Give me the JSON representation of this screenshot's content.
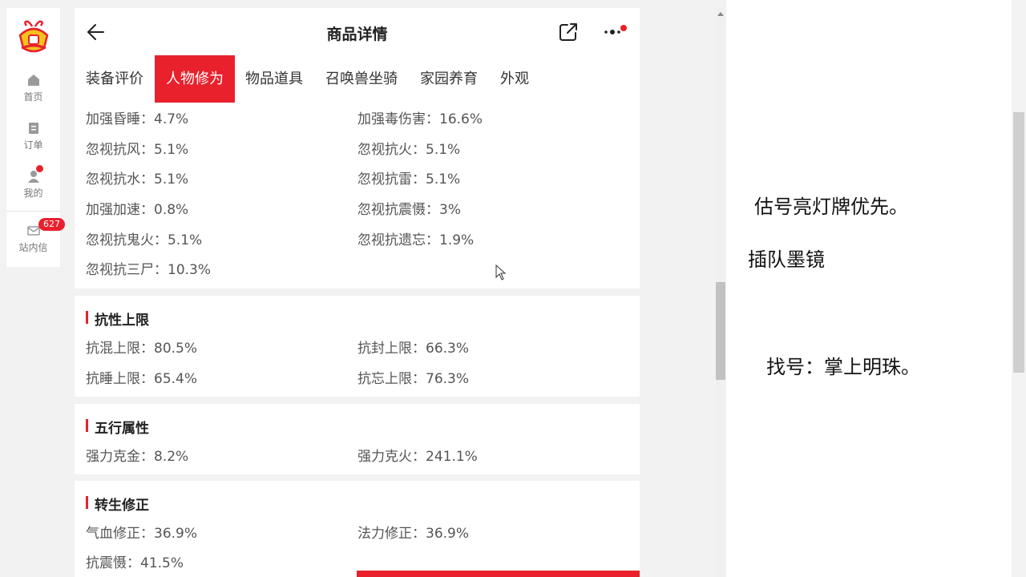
{
  "sidebar": {
    "items": [
      {
        "label": "首页",
        "icon": "home-icon"
      },
      {
        "label": "订单",
        "icon": "order-icon"
      },
      {
        "label": "我的",
        "icon": "user-icon"
      },
      {
        "label": "站内信",
        "icon": "mail-icon"
      }
    ],
    "mail_count": "627"
  },
  "header": {
    "title": "商品详情"
  },
  "tabs": [
    "装备评价",
    "人物修为",
    "物品道具",
    "召唤兽坐骑",
    "家园养育",
    "外观"
  ],
  "attributes_top": [
    [
      "加强昏睡：4.7%",
      "加强毒伤害：16.6%"
    ],
    [
      "忽视抗风：5.1%",
      "忽视抗火：5.1%"
    ],
    [
      "忽视抗水：5.1%",
      "忽视抗雷：5.1%"
    ],
    [
      "加强加速：0.8%",
      "忽视抗震慑：3%"
    ],
    [
      "忽视抗鬼火：5.1%",
      "忽视抗遗忘：1.9%"
    ],
    [
      "忽视抗三尸：10.3%",
      ""
    ]
  ],
  "resist_limit": {
    "title": "抗性上限",
    "rows": [
      [
        "抗混上限：80.5%",
        "抗封上限：66.3%"
      ],
      [
        "抗睡上限：65.4%",
        "抗忘上限：76.3%"
      ]
    ]
  },
  "five_elements": {
    "title": "五行属性",
    "rows": [
      [
        "强力克金：8.2%",
        "强力克火：241.1%"
      ]
    ]
  },
  "rebirth": {
    "title": "转生修正",
    "rows": [
      [
        "气血修正：36.9%",
        "法力修正：36.9%"
      ],
      [
        "抗震慑：41.5%",
        ""
      ]
    ]
  },
  "notes": {
    "line1": "估号亮灯牌优先。",
    "line2": "插队墨镜",
    "line3": "找号：掌上明珠。"
  },
  "colors": {
    "accent": "#e8212d"
  }
}
